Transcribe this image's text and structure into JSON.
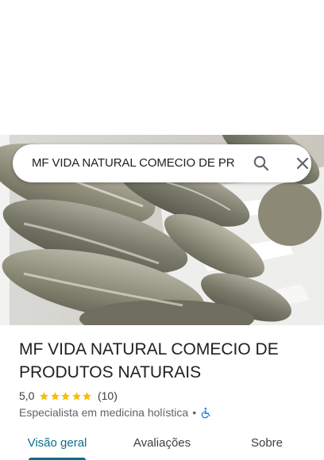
{
  "search": {
    "value": "MF VIDA NATURAL COMECIO DE PR"
  },
  "place": {
    "title": "MF VIDA NATURAL COMECIO DE PRODUTOS NATURAIS",
    "rating": "5,0",
    "stars": 5,
    "review_count": "(10)",
    "category": "Especialista em medicina holística",
    "separator": "•"
  },
  "tabs": [
    {
      "label": "Visão geral",
      "active": true
    },
    {
      "label": "Avaliações",
      "active": false
    },
    {
      "label": "Sobre",
      "active": false
    }
  ],
  "colors": {
    "accent": "#0b6e8a",
    "star": "#fbbc04",
    "accessibility": "#1a73e8"
  }
}
